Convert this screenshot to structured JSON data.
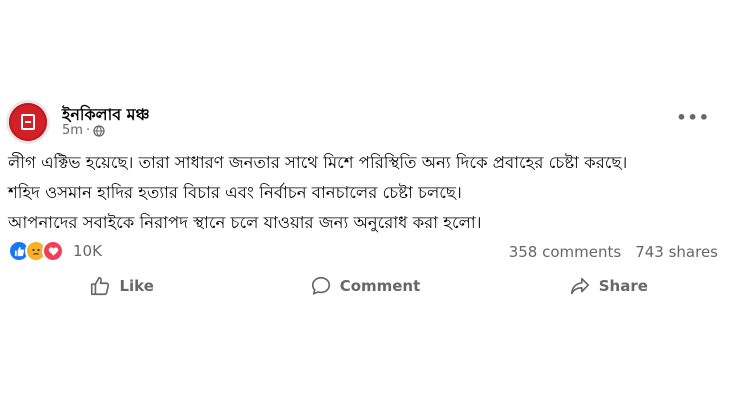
{
  "post": {
    "author": "ইনকিলাব মঞ্চ",
    "time": "5m",
    "lines": [
      "লীগ এক্টিভ হয়েছে। তারা সাধারণ জনতার সাথে মিশে পরিস্থিতি অন্য দিকে প্রবাহের চেষ্টা করছে।",
      "শহিদ ওসমান হাদির হত্যার বিচার এবং নির্বাচন বানচালের চেষ্টা চলছে।",
      "আপনাদের সবাইকে নিরাপদ স্থানে চলে যাওয়ার জন্য অনুরোধ করা হলো।"
    ],
    "reactions_count": "10K",
    "comments": "358 comments",
    "shares": "743 shares"
  },
  "actions": {
    "like": "Like",
    "comment": "Comment",
    "share": "Share"
  },
  "colors": {
    "avatar_red": "#d32027",
    "text_secondary": "#65676b",
    "like_blue": "#1877f2",
    "love_red": "#f33e58",
    "sad_yellow": "#f7b125"
  }
}
